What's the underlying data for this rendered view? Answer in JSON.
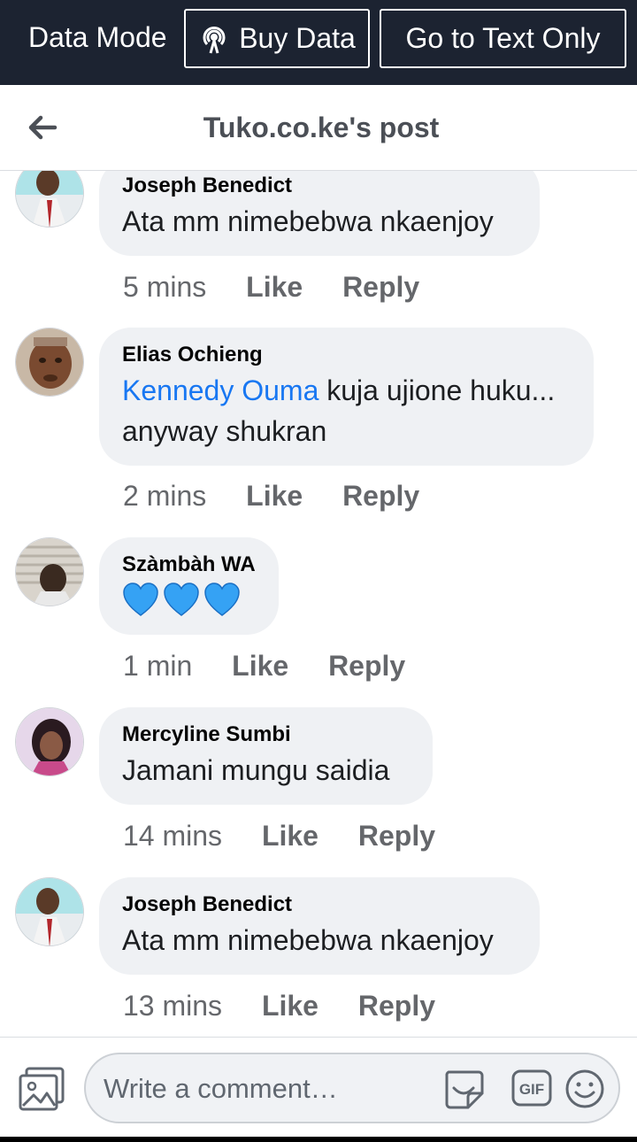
{
  "data_bar": {
    "mode_label": "Data Mode",
    "buy_label": "Buy Data",
    "text_only_label": "Go to Text Only"
  },
  "header": {
    "title": "Tuko.co.ke's post"
  },
  "comments": [
    {
      "name": "Joseph Benedict",
      "text": "Ata mm nimebebwa nkaenjoy",
      "time": "5 mins",
      "like": "Like",
      "reply": "Reply"
    },
    {
      "name": "Elias Ochieng",
      "mention": "Kennedy Ouma",
      "text_line1": " kuja ujione huku...",
      "text_line2": "anyway shukran",
      "time": "2 mins",
      "like": "Like",
      "reply": "Reply"
    },
    {
      "name": "Szàmbàh WA",
      "text": "💙💙💙",
      "time": "1 min",
      "like": "Like",
      "reply": "Reply"
    },
    {
      "name": "Mercyline Sumbi",
      "text": "Jamani mungu saidia",
      "time": "14 mins",
      "like": "Like",
      "reply": "Reply"
    },
    {
      "name": "Joseph Benedict",
      "text": "Ata mm nimebebwa nkaenjoy",
      "time": "13 mins",
      "like": "Like",
      "reply": "Reply"
    }
  ],
  "composer": {
    "placeholder": "Write a comment…"
  },
  "icons": {
    "buy": "broadcast-icon",
    "back": "back-arrow-icon",
    "photo": "photo-icon",
    "sticker": "sticker-icon",
    "gif": "gif-icon",
    "emoji": "emoji-icon"
  },
  "colors": {
    "data_bar_bg": "#1c2331",
    "mention": "#1877f2",
    "bubble_bg": "#eff1f4",
    "heart": "#35a2f4"
  }
}
